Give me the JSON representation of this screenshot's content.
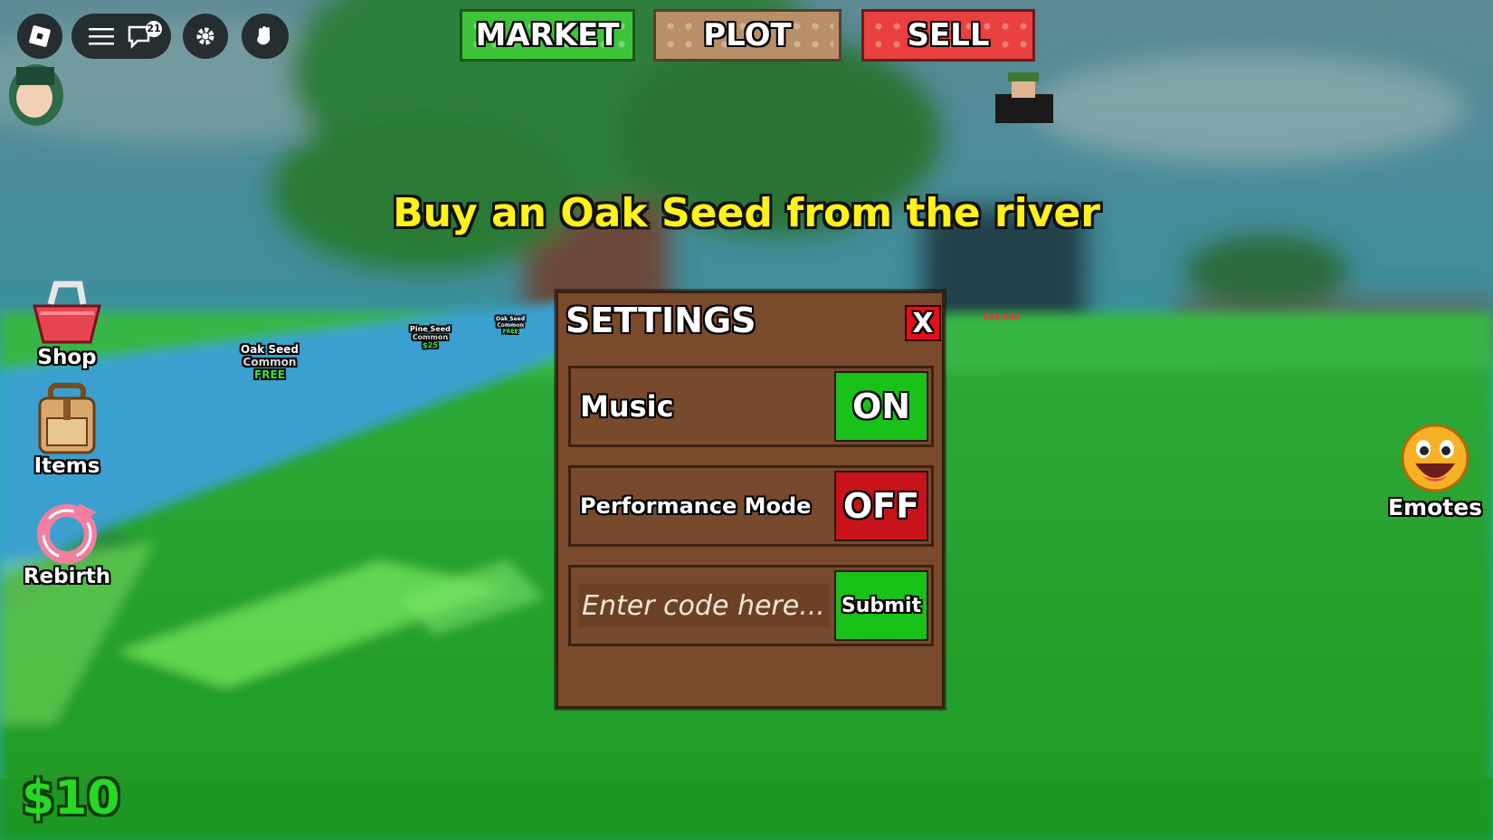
{
  "topbar": {
    "market_label": "MARKET",
    "plot_label": "PLOT",
    "sell_label": "SELL",
    "chat_badge": "21"
  },
  "quest_text": "Buy an Oak Seed from the river",
  "side_menu": {
    "shop_label": "Shop",
    "items_label": "Items",
    "rebirth_label": "Rebirth",
    "emotes_label": "Emotes"
  },
  "money": "$10",
  "world_tags": [
    {
      "name": "Oak Seed",
      "rarity": "Common",
      "price": "FREE"
    },
    {
      "name": "Pine Seed",
      "rarity": "Common",
      "price": "$25"
    },
    {
      "name": "Oak Seed",
      "rarity": "Common",
      "price": "FREE"
    }
  ],
  "player_money_tag": "$35,640",
  "settings": {
    "title": "SETTINGS",
    "close_label": "X",
    "music_label": "Music",
    "music_state": "ON",
    "performance_label": "Performance Mode",
    "performance_state": "OFF",
    "code_placeholder": "Enter code here...",
    "submit_label": "Submit"
  },
  "colors": {
    "on": "#18c218",
    "off": "#c9131b",
    "panel": "#7a4a2c",
    "quest": "#fff21a",
    "money": "#27d825"
  }
}
